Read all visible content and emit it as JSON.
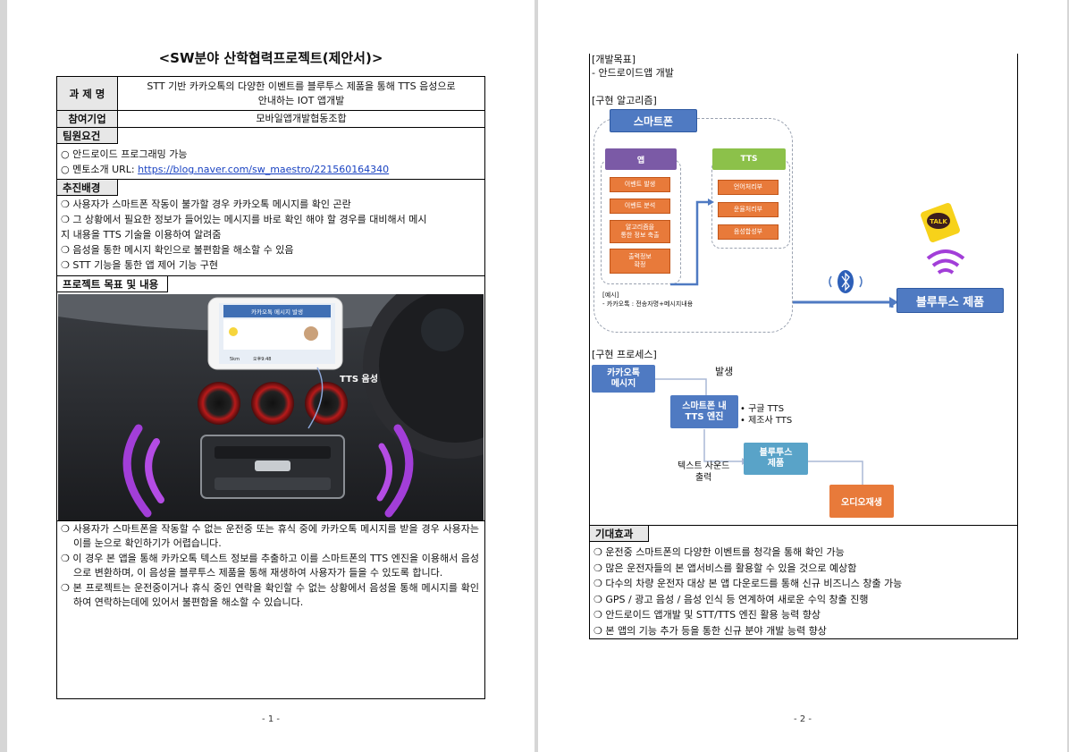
{
  "page1": {
    "title": "<SW분야 산학협력프로젝트(제안서)>",
    "task_label": "과 제 명",
    "task_value_line1": "STT 기반 카카오톡의 다양한 이벤트를 블루투스 제품을 통해 TTS 음성으로",
    "task_value_line2": "안내하는 IOT 앱개발",
    "org_label": "참여기업",
    "org_value": "모바일앱개발협동조합",
    "req_label": "팀원요건",
    "req_items": [
      "○ 안드로이드 프로그래밍 가능",
      "○ 멘토소개 URL: "
    ],
    "req_link": "https://blog.naver.com/sw_maestro/221560164340",
    "bg_label": "추진배경",
    "bg_items": [
      "❍ 사용자가 스마트폰 작동이 불가할 경우 카카오톡 메시지를 확인 곤란",
      "❍ 그 상황에서 필요한 정보가 들어있는 메시지를 바로 확인 해야 할 경우를 대비해서 메시",
      "지 내용을 TTS 기술을 이용하여 알려줌",
      "❍ 음성을 통한 메시지 확인으로 불편함을 해소할 수 있음",
      "❍ STT 기능을 통한 앱 제어 기능 구현"
    ],
    "goal_label": "프로젝트 목표 및 내용",
    "photo": {
      "banner": "카카오톡 메시지 발생",
      "tts_label": "TTS 음성",
      "distance": "5km",
      "time": "오후9:48"
    },
    "paras": [
      "❍ 사용자가 스마트폰을 작동할 수 없는 운전중 또는 휴식 중에 카카오톡 메시지를 받을 경우 사용자는 이를 눈으로 확인하기가 어렵습니다.",
      "❍ 이 경우 본 앱을 통해 카카오톡 텍스트 정보를 추출하고 이를 스마트폰의 TTS 엔진을 이용해서 음성으로 변환하며, 이 음성을 블루투스 제품을 통해 재생하여 사용자가 들을 수 있도록 합니다.",
      "❍ 본 프로젝트는 운전중이거나 휴식 중인 연락을 확인할 수 없는 상황에서 음성을 통해 메시지를 확인하여 연락하는데에 있어서 불편함을 해소할 수 있습니다."
    ],
    "page_number": "- 1 -"
  },
  "page2": {
    "dev_goal_head": "[개발목표]",
    "dev_goal_item": "-  안드로이드앱 개발",
    "algo_head": "[구현 알고리즘]",
    "smartphone": "스마트폰",
    "app": "앱",
    "tts": "TTS",
    "app_steps": [
      "이벤트 발생",
      "이벤트 분석",
      "알고리즘을\n통한 정보 축출",
      "출력정보\n확정"
    ],
    "tts_steps": [
      "언어처리부",
      "운율처리부",
      "음성합성부"
    ],
    "example_head": "[예시]",
    "example_item": "-   카카오톡 : 전송자명+메시지내용",
    "bt_product": "블루투스 제품",
    "talk": "TALK",
    "process_head": "[구현 프로세스]",
    "kakao_msg": "카카오톡\n메시지",
    "occur": "발생",
    "engine": "스마트폰 내\nTTS 엔진",
    "engine_notes": [
      "•  구글 TTS",
      "•  제조사 TTS"
    ],
    "bt_box": "블루투스\n제품",
    "text_sound": "텍스트 사운드\n출력",
    "audio": "오디오재생",
    "effect_label": "기대효과",
    "effects": [
      "❍ 운전중 스마트폰의 다양한 이벤트를 청각을 통해 확인 가능",
      "❍ 많은 운전자들의 본 앱서비스를 활용할 수 있을 것으로 예상함",
      "❍ 다수의 차량 운전자 대상 본 앱 다운로드를 통해 신규 비즈니스 창출 가능",
      "❍ GPS / 광고 음성 / 음성 인식 등 연계하여 새로운 수익 창출 진행",
      "❍ 안드로이드 앱개발 및 STT/TTS 엔진 활용 능력 향상",
      "❍ 본 앱의 기능 추가 등을 통한 신규 분야 개발 능력 향상"
    ],
    "page_number": "- 2 -"
  },
  "colors": {
    "blue_box": "#4f7ac2",
    "purple_box": "#7b5aa6",
    "green_box": "#8cc14a",
    "orange_box": "#e87a3a",
    "teal_box": "#59a3c8"
  }
}
